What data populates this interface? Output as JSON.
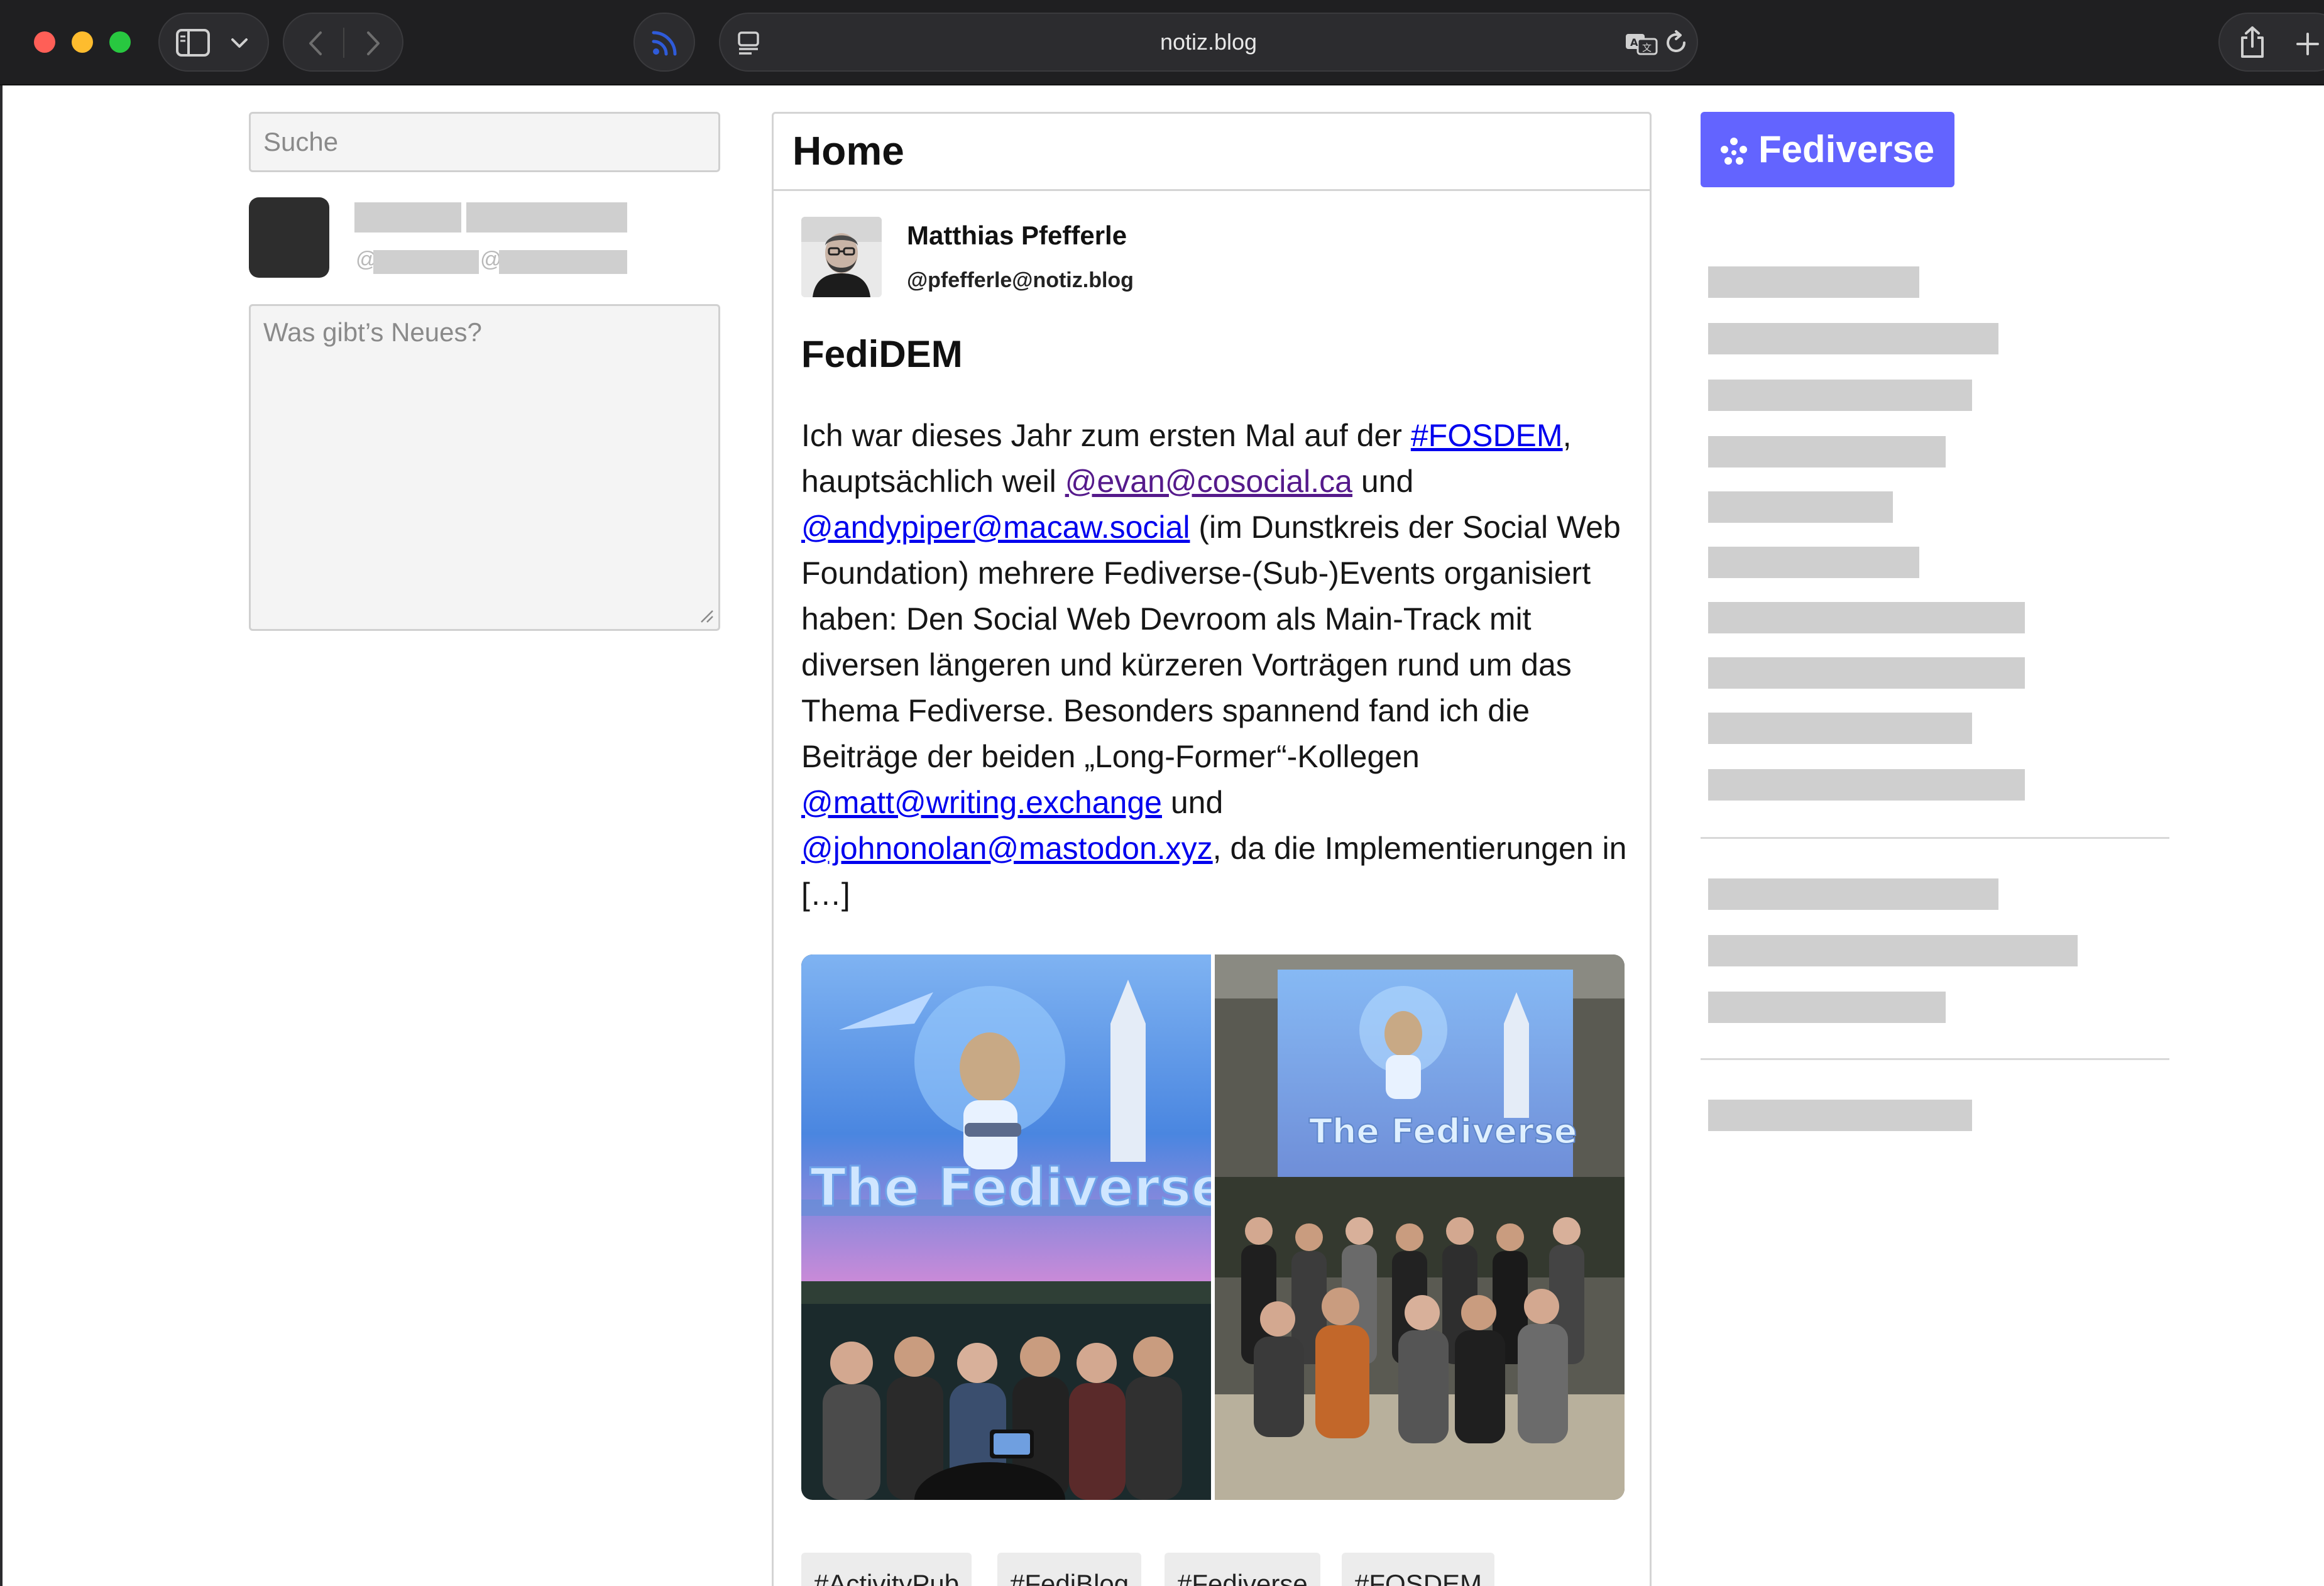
{
  "browser": {
    "url": "notiz.blog"
  },
  "left_column": {
    "search_placeholder": "Suche",
    "user_handle_placeholder": "@",
    "user_handle_placeholder_2": "@",
    "compose_placeholder": "Was gibt’s Neues?"
  },
  "main": {
    "title": "Home",
    "post": {
      "author_name": "Matthias Pfefferle",
      "author_handle": "@pfefferle@notiz.blog",
      "title": "FediDEM",
      "body": {
        "t1": "Ich war dieses Jahr zum ersten Mal auf der ",
        "link_fosdem": "#FOSDEM",
        "t2": ", hauptsächlich weil ",
        "link_evan": "@evan@cosocial.ca",
        "t3": " und ",
        "link_andy": "@andypiper@macaw.social",
        "t4": " (im Dunstkreis der Social Web Foundation) mehrere Fediverse-(Sub-)Events organisiert haben: Den Social Web Devroom als Main-Track mit diversen längeren und kürzeren Vorträgen rund um das Thema Fediverse. Besonders spannend fand ich die Beiträge der beiden „Long-Former“-Kollegen ",
        "link_matt": "@matt@writing.exchange",
        "t5": " und ",
        "link_john": "@johnonolan@mastodon.xyz",
        "t6": ", da die Implementierungen in […]"
      },
      "photo_left_slide_text": "The Fediverse",
      "photo_right_slide_text": "The Fediverse",
      "tags": [
        "#ActivityPub",
        "#FediBlog",
        "#Fediverse",
        "#FOSDEM"
      ]
    }
  },
  "right_column": {
    "badge_label": "Fediverse"
  },
  "colors": {
    "fediverse_purple": "#6364ff",
    "link_blue": "#0000ee",
    "link_visited": "#551a8b"
  }
}
